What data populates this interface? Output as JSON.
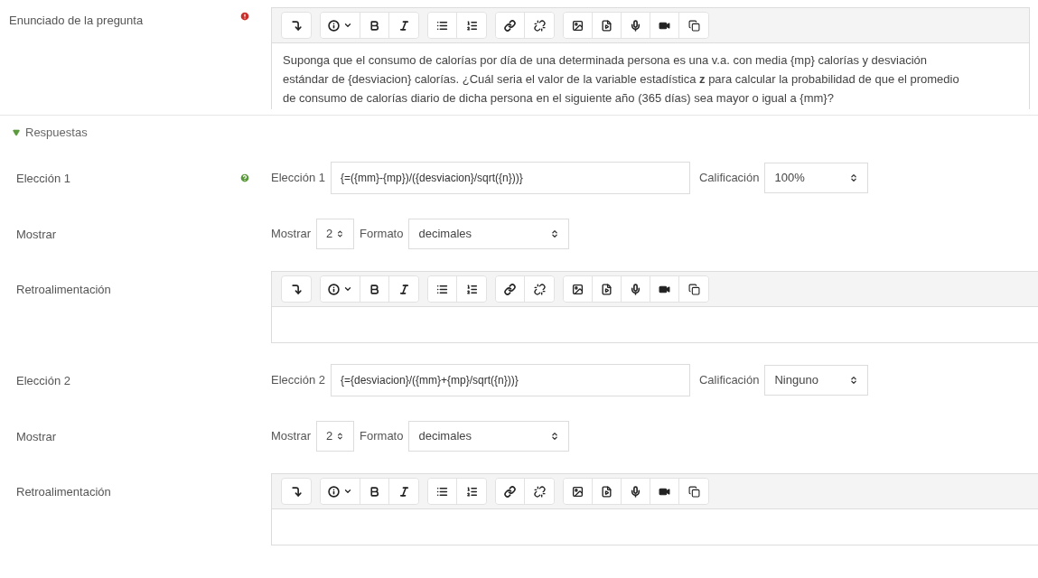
{
  "question": {
    "label": "Enunciado de la pregunta",
    "required": true,
    "text": "Suponga que el consumo de calorías por día de una determinada persona es una v.a. con media {mp} calorías y desviación estándar de {desviacion} calorías. ¿Cuál seria el valor de la variable estadística **z** para calcular la probabilidad de que el promedio de consumo de calorías diario de dicha persona en el siguiente año (365 días) sea mayor o igual a {mm}?"
  },
  "section": {
    "label": "Respuestas",
    "expanded": true
  },
  "answers": [
    {
      "label": "Elección 1",
      "help": true,
      "field_label": "Elección 1",
      "formula": "{=({mm}-{mp})/({desviacion}/sqrt({n}))}",
      "grade_label": "Calificación",
      "grade": "100%",
      "show_row_label": "Mostrar",
      "show_label": "Mostrar",
      "decimals": "2",
      "format_label": "Formato",
      "format": "decimales",
      "feedback_label": "Retroalimentación"
    },
    {
      "label": "Elección 2",
      "help": false,
      "field_label": "Elección 2",
      "formula": "{={desviacion}/({mm}+{mp}/sqrt({n}))}",
      "grade_label": "Calificación",
      "grade": "Ninguno",
      "show_row_label": "Mostrar",
      "show_label": "Mostrar",
      "decimals": "2",
      "format_label": "Formato",
      "format": "decimales",
      "feedback_label": "Retroalimentación"
    }
  ]
}
